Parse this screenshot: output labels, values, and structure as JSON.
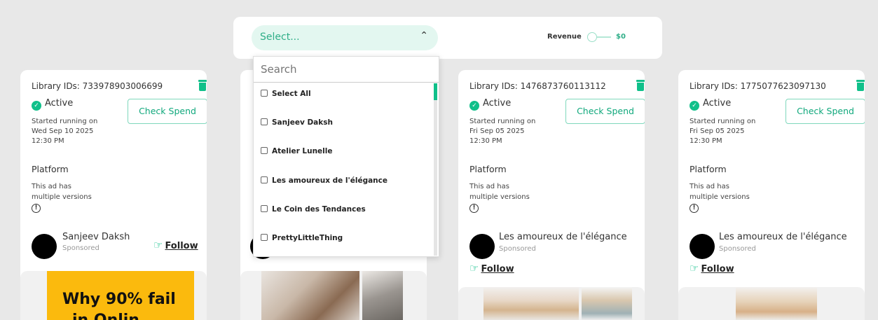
{
  "filter": {
    "select_placeholder": "Select...",
    "revenue_label": "Revenue",
    "revenue_value": "$0"
  },
  "dropdown": {
    "search_placeholder": "Search",
    "items": [
      "Select All",
      "Sanjeev Daksh",
      "Atelier Lunelle",
      "Les amoureux de l'élégance",
      "Le Coin des Tendances",
      "PrettyLittleThing"
    ]
  },
  "cards": [
    {
      "library_id": "Library IDs: 733978903006699",
      "status": "Active",
      "started_line1": "Started running on",
      "started_line2": "Wed Sep 10 2025",
      "started_line3": "12:30 PM",
      "check_spend": "Check Spend",
      "platform": "Platform",
      "versions_line1": "This ad has",
      "versions_line2": "multiple versions",
      "advertiser": "Sanjeev Daksh",
      "sponsored": "Sponsored",
      "follow": "Follow",
      "creative_line1": "Why 90% fail",
      "creative_line2": "in Onlin"
    },
    {
      "library_id": "Library IDs: 1476873760113112",
      "status": "Active",
      "started_line1": "Started running on",
      "started_line2": "Fri Sep 05 2025",
      "started_line3": "12:30 PM",
      "check_spend": "Check Spend",
      "platform": "Platform",
      "versions_line1": "This ad has",
      "versions_line2": "multiple versions",
      "advertiser": "Les amoureux de l'élégance",
      "sponsored": "Sponsored",
      "follow": "Follow"
    },
    {
      "library_id": "Library IDs: 1775077623097130",
      "status": "Active",
      "started_line1": "Started running on",
      "started_line2": "Fri Sep 05 2025",
      "started_line3": "12:30 PM",
      "check_spend": "Check Spend",
      "platform": "Platform",
      "versions_line1": "This ad has",
      "versions_line2": "multiple versions",
      "advertiser": "Les amoureux de l'élégance",
      "sponsored": "Sponsored",
      "follow": "Follow"
    }
  ],
  "colors": {
    "accent": "#10c08a",
    "select_bg": "#e3f7f0",
    "ad_yellow": "#fbba0d",
    "page_bg": "#e8e8e8"
  }
}
